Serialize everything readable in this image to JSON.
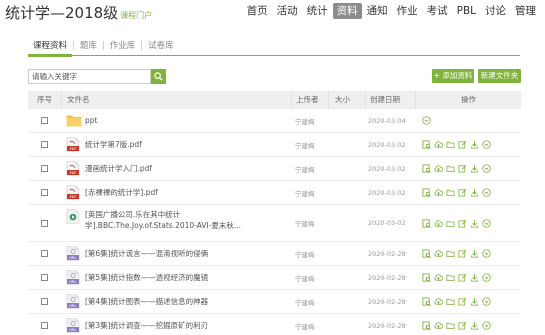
{
  "header": {
    "title": "统计学—2018级",
    "subtitle": "课程门户",
    "nav": [
      "首页",
      "活动",
      "统计",
      "资料",
      "通知",
      "作业",
      "考试",
      "PBL",
      "讨论",
      "管理"
    ],
    "active_nav": 3
  },
  "tabs": [
    "课程资料",
    "题库",
    "作业库",
    "试卷库"
  ],
  "toolbar": {
    "search_placeholder": "请输入关键字",
    "add_button": "+ 添加资料",
    "new_folder_button": "新建文件夹"
  },
  "table": {
    "headers": {
      "seq": "序号",
      "name": "文件名",
      "uploader": "上传者",
      "size": "大小",
      "date": "创建日期",
      "ops": "操作"
    },
    "rows": [
      {
        "type": "folder",
        "name": "ppt",
        "uploader": "宁建梅",
        "date": "2020-03-04"
      },
      {
        "type": "pdf",
        "name": "统计学第7版.pdf",
        "uploader": "宁建梅",
        "date": "2020-03-02"
      },
      {
        "type": "pdf",
        "name": "漫画统计学入门.pdf",
        "uploader": "宁建梅",
        "date": "2020-03-02"
      },
      {
        "type": "pdf",
        "name": "[赤裸裸的统计学].pdf",
        "uploader": "宁建梅",
        "date": "2020-03-02"
      },
      {
        "type": "video",
        "name": "[英国广播公司.乐在其中统计学].BBC.The.Joy.of.Stats.2010-AVI-夏末秋...",
        "uploader": "宁建梅",
        "date": "2020-03-02"
      },
      {
        "type": "url",
        "name": "[第6集]统计谎言——混淆视听的侵俩",
        "uploader": "宁建梅",
        "date": "2020-02-28"
      },
      {
        "type": "url",
        "name": "[第5集]统计指数——透视经济的魔镜",
        "uploader": "宁建梅",
        "date": "2020-02-28"
      },
      {
        "type": "url",
        "name": "[第4集]统计图表——描述信息的神器",
        "uploader": "宁建梅",
        "date": "2020-02-28"
      },
      {
        "type": "url",
        "name": "[第3集]统计调查——挖掘原矿的利刃",
        "uploader": "宁建梅",
        "date": "2020-02-28"
      }
    ]
  },
  "colors": {
    "accent": "#7fb33c",
    "pdf": "#c0392b",
    "folder": "#f5c242",
    "url": "#8e7cc3",
    "video": "#2e9e5b"
  }
}
